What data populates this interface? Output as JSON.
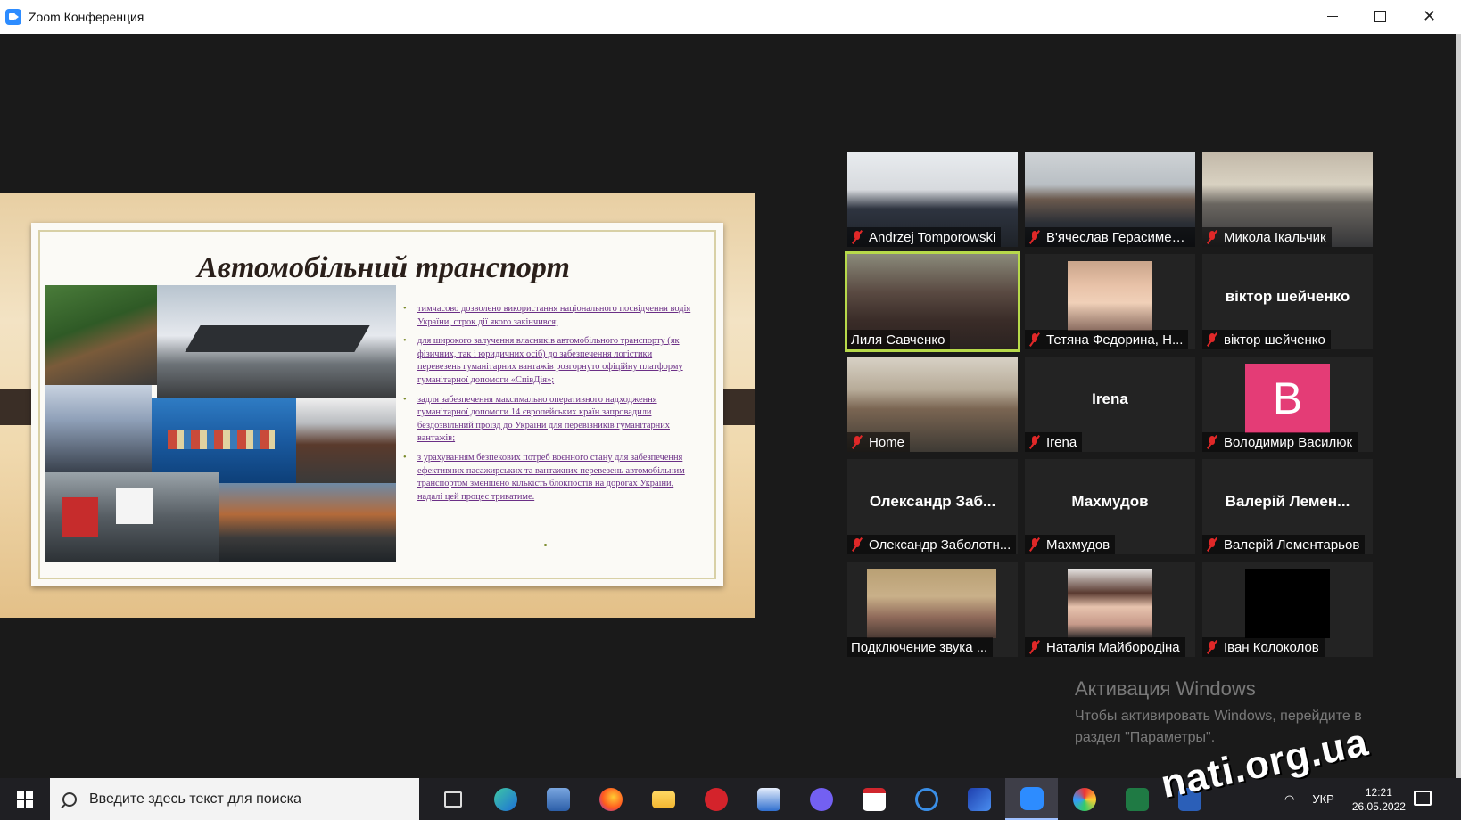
{
  "window": {
    "title": "Zoom Конференция",
    "controls": {
      "minimize": "minimize-icon",
      "maximize": "maximize-icon",
      "close": "close-icon"
    }
  },
  "slide": {
    "title": "Автомобільний транспорт",
    "bullets": [
      "тимчасово дозволено використання національного посвідчення водія України, строк дії якого закінчився;",
      "для широкого залучення власників автомобільного транспорту (як фізичних, так і юридичних осіб) до забезпечення логістики перевезень гуманітарних вантажів розгорнуто офіційну платформу гуманітарної допомоги «СпівДія»;",
      "задля забезпечення максимально оперативного надходження гуманітарної допомоги 14 європейських країн запровадили бездозвільний проїзд до України для перевізників гуманітарних вантажів;",
      "з урахуванням безпекових потреб воєнного стану для забезпечення ефективних пасажирських та вантажних перевезень автомобільним транспортом зменшено кількість блокпостів на дорогах України, надалі цей процес триватиме."
    ],
    "colors": {
      "title": "#2a1f1a",
      "bullet_text": "#6b2f86",
      "frame": "#e8cfa3"
    }
  },
  "participants": [
    {
      "name": "Andrzej Tomporowski",
      "muted": true,
      "type": "video"
    },
    {
      "name": "В'ячеслав Герасимен...",
      "muted": true,
      "type": "video"
    },
    {
      "name": "Микола Ікальчик",
      "muted": true,
      "type": "video"
    },
    {
      "name": "Лиля Савченко",
      "muted": false,
      "type": "video",
      "active_speaker": true
    },
    {
      "name": "Тетяна Федорина, Н...",
      "muted": true,
      "type": "photo"
    },
    {
      "name": "віктор шейченко",
      "display": "віктор шейченко",
      "muted": true,
      "type": "name"
    },
    {
      "name": "Home",
      "muted": true,
      "type": "video"
    },
    {
      "name": "Irena",
      "display": "Irena",
      "muted": true,
      "type": "name"
    },
    {
      "name": "Володимир Василюк",
      "avatar_letter": "B",
      "muted": true,
      "type": "avatar"
    },
    {
      "name": "Олександр Заболотн...",
      "display": "Олександр Заб...",
      "muted": true,
      "type": "name"
    },
    {
      "name": "Махмудов",
      "display": "Махмудов",
      "muted": true,
      "type": "name"
    },
    {
      "name": "Валерій Лементарьов",
      "display": "Валерій Лемен...",
      "muted": true,
      "type": "name"
    },
    {
      "name": "Подключение звука ...",
      "muted": false,
      "type": "video"
    },
    {
      "name": "Наталія Майбородіна",
      "muted": true,
      "type": "photo"
    },
    {
      "name": "Іван Колоколов",
      "muted": true,
      "type": "black"
    }
  ],
  "activation": {
    "title": "Активация Windows",
    "text": "Чтобы активировать Windows, перейдите в раздел \"Параметры\"."
  },
  "watermark": "nati.org.ua",
  "taskbar": {
    "search_placeholder": "Введите здесь текст для поиска",
    "apps": [
      "task-view-icon",
      "edge-icon",
      "monitor-app-icon",
      "firefox-icon",
      "file-explorer-icon",
      "red-app-icon",
      "blue-window-icon",
      "viber-icon",
      "pdf-icon",
      "blue-circle-app-icon",
      "blue-square-app-icon",
      "zoom-icon",
      "paint-icon",
      "excel-icon",
      "word-icon"
    ],
    "language": "УКР",
    "time": "12:21",
    "date": "26.05.2022"
  },
  "colors": {
    "active_speaker_outline": "#b7d94a",
    "muted_mic": "#e02828",
    "avatar_pink": "#e43c76",
    "zoom_blue": "#2d8cff"
  }
}
